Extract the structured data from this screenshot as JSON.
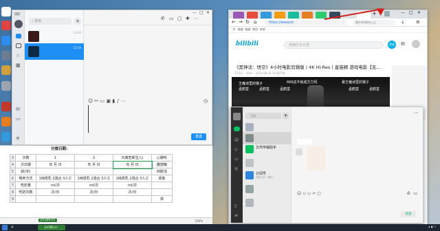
{
  "desktop": {
    "icons": [
      "qq-icon",
      "browser-icon",
      "shield-icon",
      "app-icon",
      "app-icon",
      "app-icon",
      "mail-icon",
      "app-icon",
      "app-icon",
      "app-icon",
      "pin-icon"
    ]
  },
  "qq": {
    "search_placeholder": "搜索",
    "items": [
      {
        "time": "13:43"
      },
      {
        "time": "13:44"
      }
    ],
    "send_label": "发送",
    "colors": {
      "accent": "#1e90f5",
      "selected_item": "#1e90f5"
    }
  },
  "sheet": {
    "header_title": "分娩日期:",
    "rows": [
      {
        "num": "3",
        "cells": [
          "次数",
          "1",
          "2",
          "3(离危新生儿)",
          "心肺听"
        ]
      },
      {
        "num": "4",
        "cells": [
          "次日期",
          "年 月 日",
          "年 月 日",
          "年 月 日",
          "腹部触"
        ]
      },
      {
        "num": "5",
        "cells": [
          "龄(天)",
          "",
          "",
          "",
          "四肢活"
        ]
      },
      {
        "num": "6",
        "cells": [
          "喂养方式",
          "1纯母乳 2混合 3人工",
          "1纯母乳 2混合 3人工",
          "1纯母乳 2混合 3人工",
          "皮肤"
        ]
      },
      {
        "num": "7",
        "cells": [
          "吃奶量",
          "ml/次",
          "ml/次",
          "ml/次",
          ""
        ]
      },
      {
        "num": "8",
        "cells": [
          "吃奶次数",
          "次/日",
          "次/日",
          "次/日",
          ""
        ]
      },
      {
        "num": "9",
        "cells": [
          "",
          "",
          "",
          "",
          "体"
        ]
      }
    ],
    "status_file": "jm189.cn",
    "zoom": "100%"
  },
  "browser": {
    "url": "https://www.bi",
    "search_text": "看bili的哪吒上山",
    "bookmarks": [
      "D",
      "链接",
      "链接",
      "常用",
      "其他"
    ],
    "bili": {
      "logo": "bilibili",
      "search_placeholder": "搜索历史记录",
      "login": "登录",
      "video_title": "《黑神话：悟空》4小时电影剪辑版丨4K Hi-Res丨直猫精 游戏电影【无…",
      "meta": "73.6万 · 4191 · 2024-08-31 12:00:59",
      "danmaku": [
        "王瘫诗里的猴子",
        "666这不就成方力吗",
        "暴王瘫诗里的猴子",
        "孟鹤堂",
        "孟鹤堂",
        "孟鹤堂",
        "孟鹤堂",
        "孟鹤堂"
      ]
    }
  },
  "wechat": {
    "search_placeholder": "搜索",
    "items": [
      {
        "name": "",
        "sub": ""
      },
      {
        "name": "",
        "sub": ""
      },
      {
        "name": "文件传输助手",
        "sub": ""
      },
      {
        "name": "",
        "sub": ""
      },
      {
        "name": "订阅号",
        "sub": "合新之外一周内…"
      },
      {
        "name": "",
        "sub": ""
      },
      {
        "name": "",
        "sub": ""
      }
    ],
    "send_label": "发送",
    "colors": {
      "accent": "#07c160",
      "rail": "#2e2e2e"
    }
  },
  "taskbar": {
    "clock": "",
    "pills": [
      "jm189.cn"
    ]
  },
  "annotation": {
    "color": "#d3201c"
  }
}
